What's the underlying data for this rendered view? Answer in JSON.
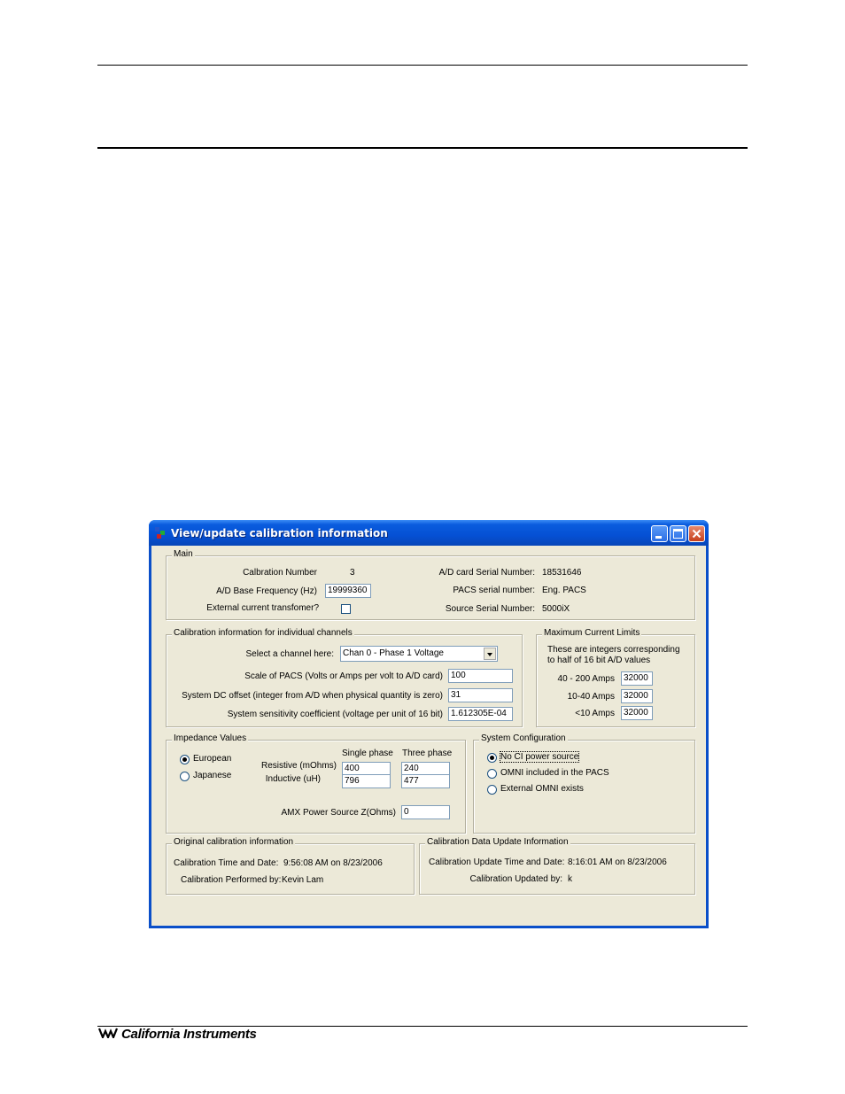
{
  "window": {
    "title": "View/update calibration information"
  },
  "main": {
    "legend": "Main",
    "calibration_number_label": "Calbration Number",
    "calibration_number_value": "3",
    "ad_base_freq_label": "A/D Base Frequency (Hz)",
    "ad_base_freq_value": "19999360",
    "ext_ct_label": "External current transfomer?",
    "ad_serial_label": "A/D card  Serial Number:",
    "ad_serial_value": "18531646",
    "pacs_serial_label": "PACS serial number:",
    "pacs_serial_value": "Eng. PACS",
    "source_serial_label": "Source Serial Number:",
    "source_serial_value": "5000iX"
  },
  "channels": {
    "legend": "Calibration information for individual channels",
    "select_label": "Select a channel here:",
    "select_value": "Chan 0 - Phase 1 Voltage",
    "scale_label": "Scale of PACS (Volts or Amps per volt to A/D card)",
    "scale_value": "100",
    "dc_offset_label": "System DC offset (integer from A/D when physical quantity is zero)",
    "dc_offset_value": "31",
    "sensitivity_label": "System sensitivity coefficient (voltage per unit of 16 bit)",
    "sensitivity_value": "1.612305E-04"
  },
  "max_current": {
    "legend": "Maximum Current Limits",
    "note_line1": "These are integers corresponding",
    "note_line2": "to half of 16 bit A/D values",
    "row1_label": "40 - 200 Amps",
    "row1_value": "32000",
    "row2_label": "10-40 Amps",
    "row2_value": "32000",
    "row3_label": "<10 Amps",
    "row3_value": "32000"
  },
  "impedance": {
    "legend": "Impedance Values",
    "european": "European",
    "japanese": "Japanese",
    "single_phase": "Single phase",
    "three_phase": "Three phase",
    "resistive_label": "Resistive (mOhms)",
    "inductive_label": "Inductive (uH)",
    "res_single": "400",
    "res_three": "240",
    "ind_single": "796",
    "ind_three": "477",
    "amx_label": "AMX Power Source Z(Ohms)",
    "amx_value": "0"
  },
  "system_config": {
    "legend": "System Configuration",
    "opt1": "No CI power source",
    "opt2": "OMNI included in the PACS",
    "opt3": "External OMNI exists"
  },
  "original": {
    "legend": "Original calibration information",
    "time_label": "Calibration Time and Date:",
    "time_value": "9:56:08 AM on 8/23/2006",
    "by_label": "Calibration Performed by:",
    "by_value": "Kevin Lam"
  },
  "update": {
    "legend": "Calibration Data Update Information",
    "time_label": "Calibration Update Time and Date:",
    "time_value": "8:16:01 AM on 8/23/2006",
    "by_label": "Calibration Updated by:",
    "by_value": "k"
  },
  "footer": {
    "logo_text": "California Instruments"
  }
}
